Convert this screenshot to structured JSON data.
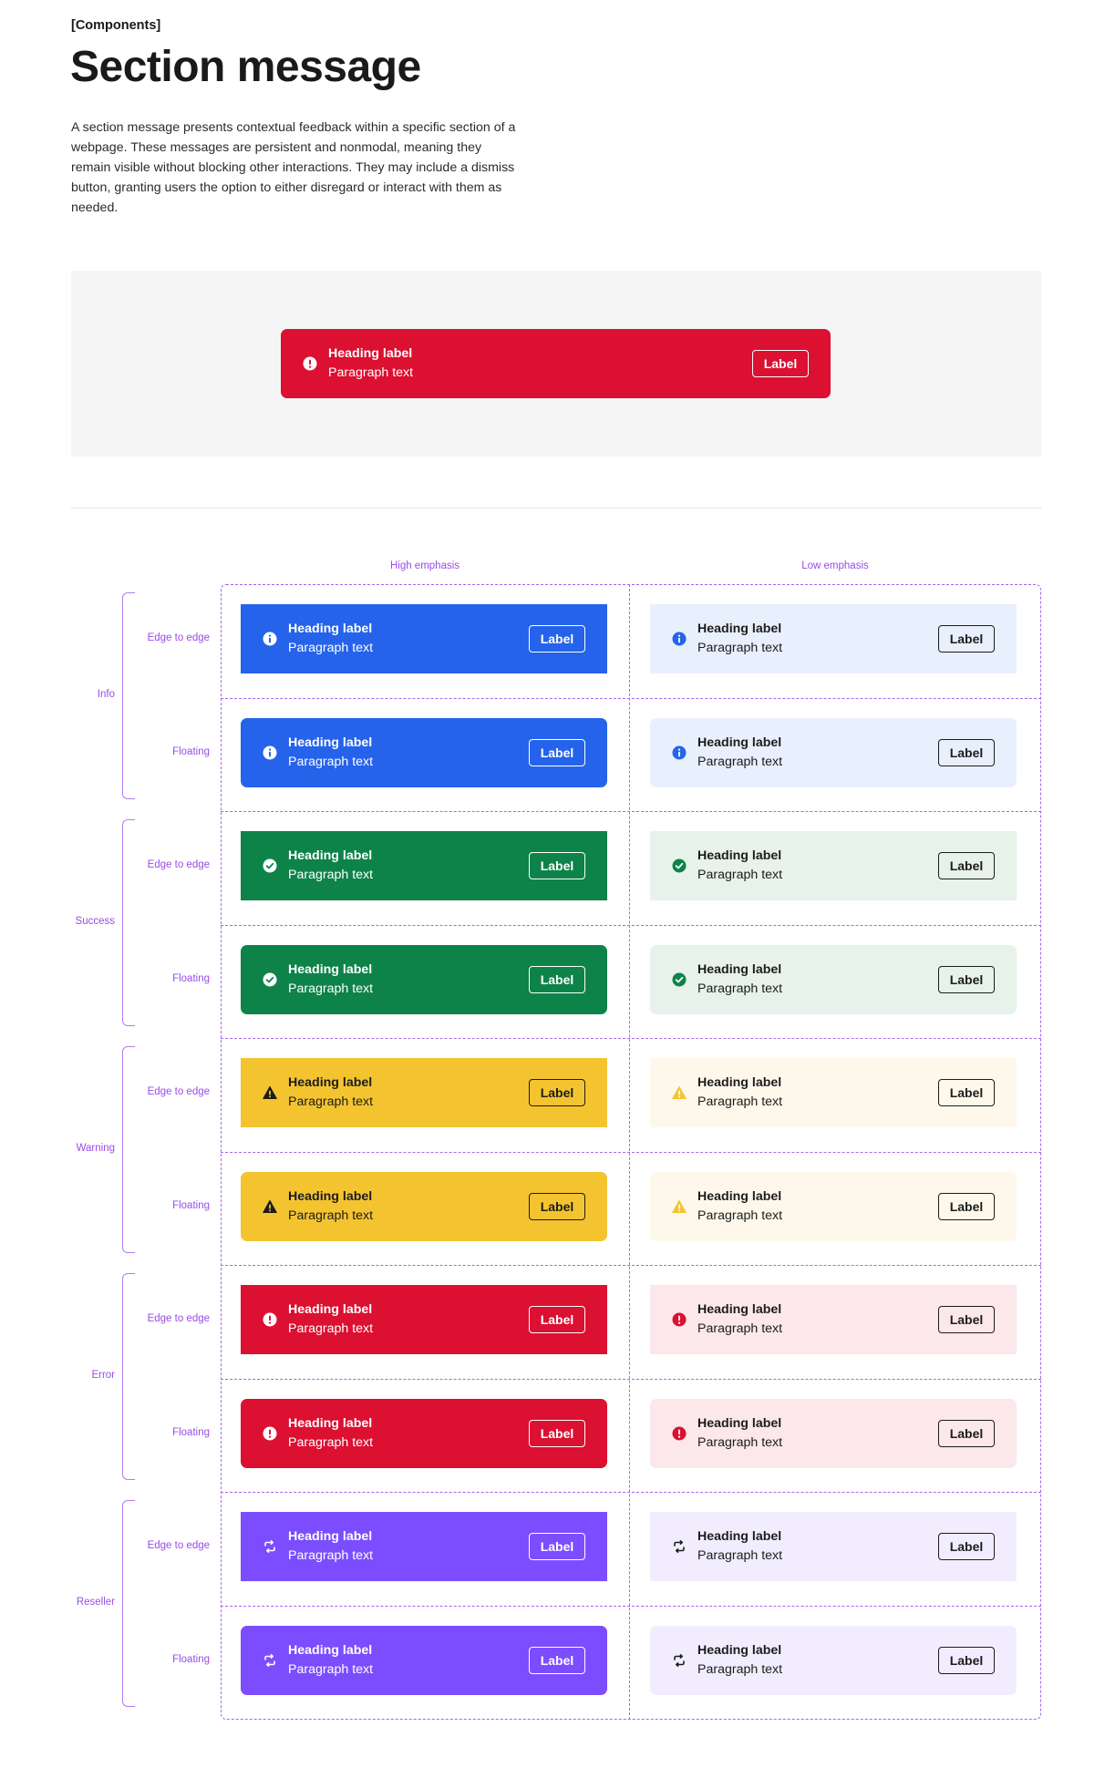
{
  "header": {
    "eyebrow": "[Components]",
    "title": "Section message",
    "description": "A section message presents contextual feedback within a specific section of a webpage. These messages are persistent and nonmodal, meaning they remain visible without blocking other interactions. They may include a dismiss button, granting users the option to either disregard or interact with them as needed."
  },
  "hero": {
    "variant": "error",
    "heading": "Heading label",
    "paragraph": "Paragraph text",
    "button_label": "Label",
    "background": "#dc1031"
  },
  "matrix": {
    "columns": [
      "High emphasis",
      "Low emphasis"
    ],
    "layouts": [
      "Edge to edge",
      "Floating"
    ],
    "groups": [
      {
        "name": "Info",
        "icon": "info-icon",
        "high_bg": "#2563eb",
        "high_fg": "#ffffff",
        "low_bg": "#e8effd",
        "low_icon_color": "#2563eb"
      },
      {
        "name": "Success",
        "icon": "check-circle-icon",
        "high_bg": "#0d8349",
        "high_fg": "#ffffff",
        "low_bg": "#e6f2ea",
        "low_icon_color": "#0d8349"
      },
      {
        "name": "Warning",
        "icon": "warning-icon",
        "high_bg": "#f4c430",
        "high_fg": "#1c1c1c",
        "low_bg": "#fdf8eb",
        "low_icon_color": "#f4c430"
      },
      {
        "name": "Error",
        "icon": "error-icon",
        "high_bg": "#dc1031",
        "high_fg": "#ffffff",
        "low_bg": "#fce7ea",
        "low_icon_color": "#dc1031"
      },
      {
        "name": "Reseller",
        "icon": "refresh-icon",
        "high_bg": "#7c4dff",
        "high_fg": "#ffffff",
        "low_bg": "#f1edfe",
        "low_icon_color": "#1c1c1c"
      }
    ],
    "message": {
      "heading": "Heading label",
      "paragraph": "Paragraph text",
      "button_label": "Label"
    },
    "guide_color": "#a666ec"
  }
}
